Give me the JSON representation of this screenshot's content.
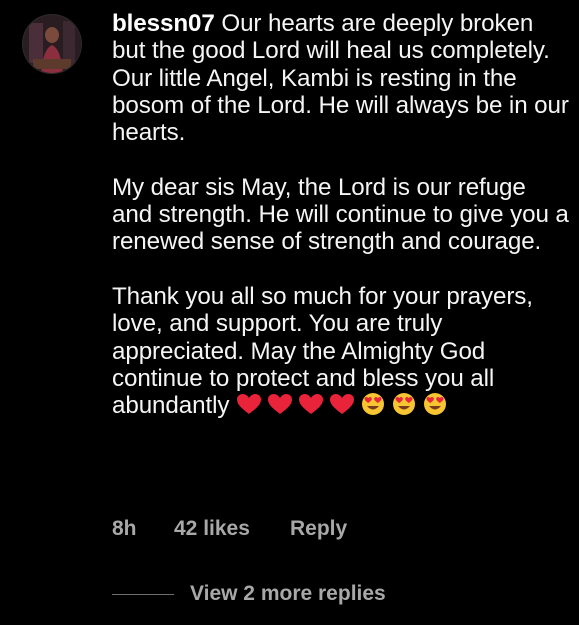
{
  "comment": {
    "username": "blessn07",
    "paragraph1": "Our hearts are deeply broken but the good Lord will heal us completely. Our little Angel, Kambi is resting in the bosom of the Lord. He will always be in our hearts.",
    "paragraph2": "My dear sis May, the Lord is our refuge and  strength. He will continue to give you a renewed sense of strength and courage.",
    "paragraph3": "Thank you all so much for your prayers, love, and support. You are truly appreciated. May the Almighty God continue to protect and bless you all abundantly",
    "emojis": [
      "red-heart",
      "red-heart",
      "red-heart",
      "red-heart",
      "heart-eyes",
      "heart-eyes",
      "heart-eyes"
    ]
  },
  "meta": {
    "time": "8h",
    "likes": "42 likes",
    "reply": "Reply"
  },
  "replies": {
    "view_more": "View 2 more replies"
  },
  "colors": {
    "background": "#000000",
    "text": "#f5f5f5",
    "muted": "#a8a8a8",
    "heart": "#e8233a",
    "emoji_face": "#f7c531"
  }
}
